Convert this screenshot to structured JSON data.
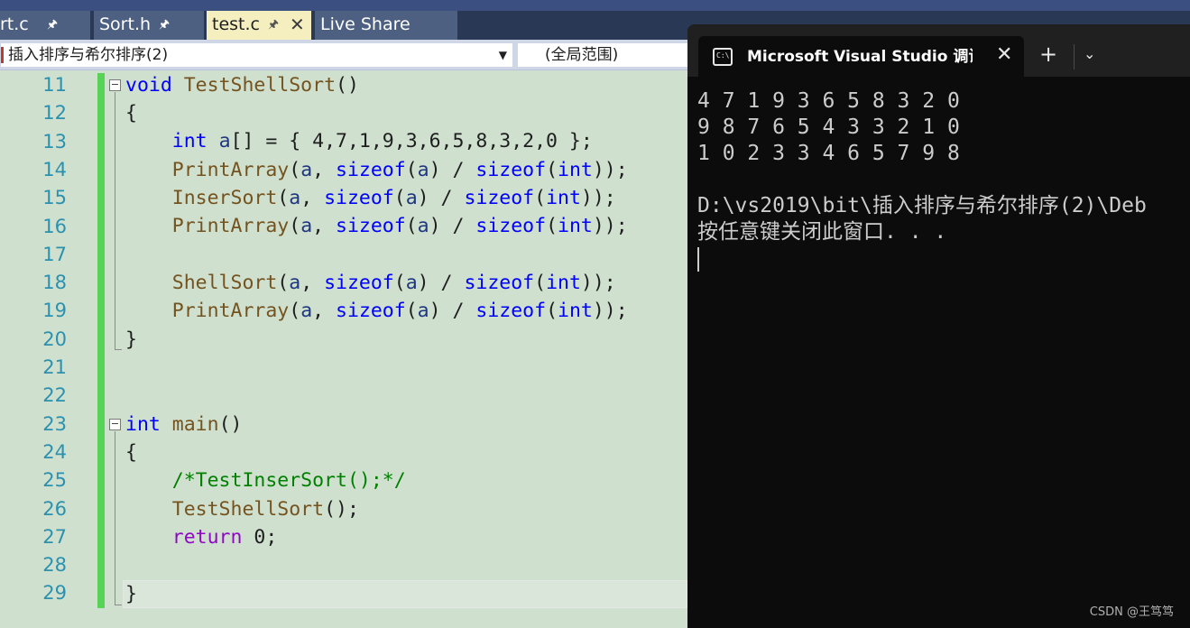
{
  "tabs": {
    "sort_c": "rt.c",
    "sort_h": "Sort.h",
    "test_c": "test.c",
    "live_share": "Live Share",
    "pin_glyph": "⊣",
    "close_glyph": "✕"
  },
  "navbar": {
    "project": "插入排序与希尔排序(2)",
    "scope": "(全局范围)",
    "dropdown_glyph": "▼"
  },
  "editor": {
    "line_numbers": [
      "11",
      "12",
      "13",
      "14",
      "15",
      "16",
      "17",
      "18",
      "19",
      "20",
      "21",
      "22",
      "23",
      "24",
      "25",
      "26",
      "27",
      "28",
      "29"
    ]
  },
  "terminal": {
    "icon_text": "C:\\",
    "tab_title": "Microsoft Visual Studio 调试控制台",
    "close_glyph": "✕",
    "new_tab_glyph": "+",
    "dropdown_glyph": "⌄",
    "lines": [
      "4 7 1 9 3 6 5 8 3 2 0",
      "9 8 7 6 5 4 3 3 2 1 0",
      "1 0 2 3 3 4 6 5 7 9 8",
      "",
      "D:\\vs2019\\bit\\插入排序与希尔排序(2)\\Deb",
      "按任意键关闭此窗口. . ."
    ]
  },
  "watermark": "CSDN @王笃笃"
}
